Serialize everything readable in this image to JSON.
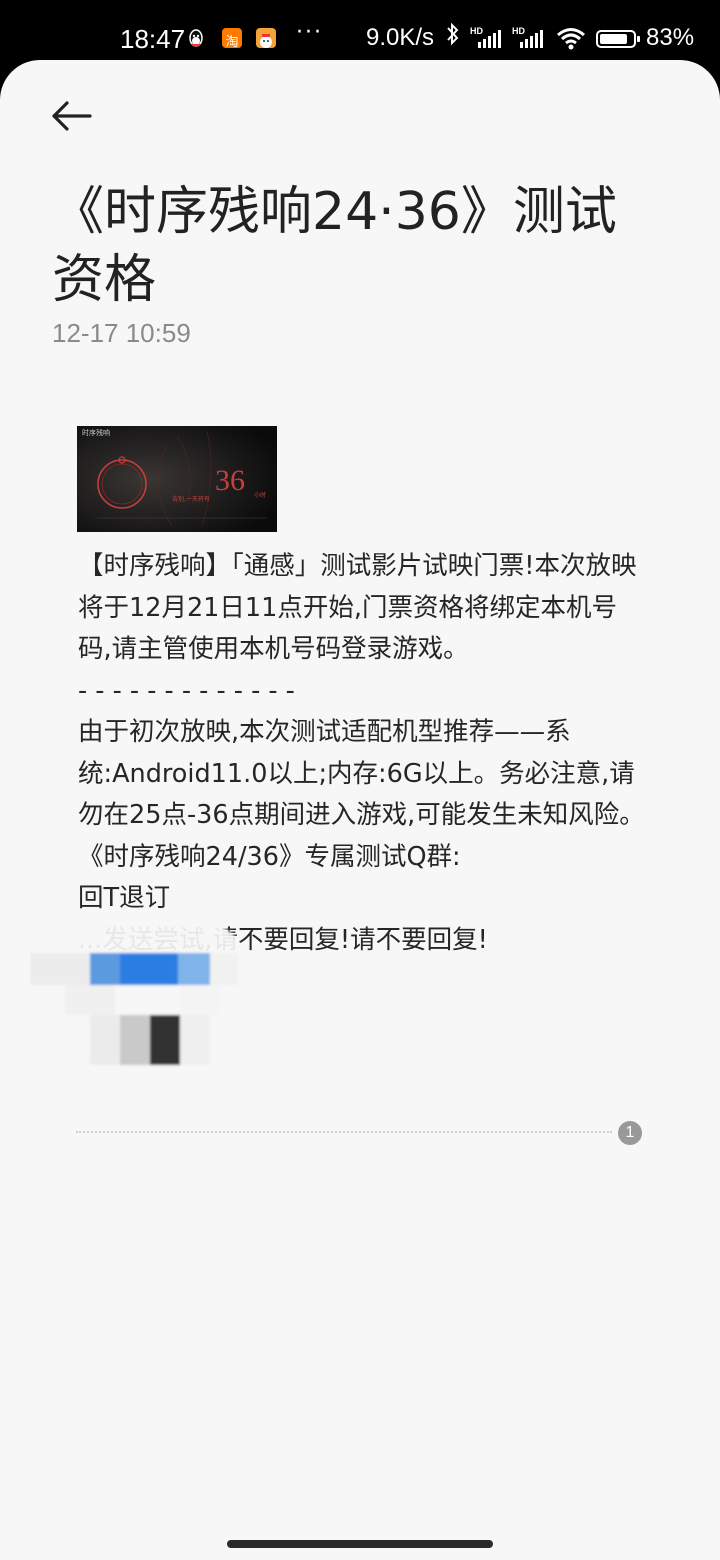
{
  "status_bar": {
    "time": "18:47",
    "app_icons": [
      "qq-icon",
      "taobao-icon",
      "app-icon"
    ],
    "more": "···",
    "net_speed": "9.0K/s",
    "bluetooth": "bluetooth-icon",
    "sim1_label": "HD",
    "sim2_label": "HD",
    "battery_level": 0.83,
    "battery_pct": "83%"
  },
  "message": {
    "title": "《时序残响24·36》测试资格",
    "timestamp": "12-17 10:59",
    "banner": {
      "logo": "时序残响",
      "number": "36",
      "unit": "小时",
      "tagline": "告别,一天将有"
    },
    "body": "【时序残响】「通感」测试影片试映门票!本次放映将于12月21日11点开始,门票资格将绑定本机号码,请主管使用本机号码登录游戏。\n- - - - - - - - - - - - -\n由于初次放映,本次测试适配机型推荐——系统:Android11.0以上;内存:6G以上。务必注意,请勿在25点-36点期间进入游戏,可能发生未知风险。\n《时序残响24/36》专属测试Q群:\n回T退订\n...发送尝试,请不要回复!请不要回复!",
    "page_number": "1"
  },
  "colors": {
    "background": "#f7f7f7",
    "title": "#222222",
    "text": "#262626",
    "timestamp": "#8a8a8a",
    "banner_accent": "#c4403c"
  }
}
